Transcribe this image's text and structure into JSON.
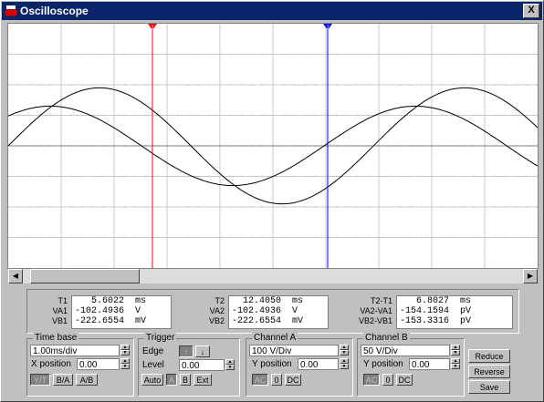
{
  "window": {
    "title": "Oscilloscope",
    "close_label": "X"
  },
  "markers": {
    "t1_label": "1",
    "t2_label": "2",
    "t1_color": "#ff0000",
    "t2_color": "#0000ff"
  },
  "readout": {
    "g1": {
      "labels": [
        "T1",
        "VA1",
        "VB1"
      ],
      "values": [
        "   5.6022  ms",
        "-102.4936  V",
        "-222.6554  mV"
      ]
    },
    "g2": {
      "labels": [
        "T2",
        "VA2",
        "VB2"
      ],
      "values": [
        "  12.4050  ms",
        "-102.4936  V",
        "-222.6554  mV"
      ]
    },
    "g3": {
      "labels": [
        "T2-T1",
        "VA2-VA1",
        "VB2-VB1"
      ],
      "values": [
        "   6.8027  ms",
        "-154.1594  pV",
        "-153.3316  pV"
      ]
    }
  },
  "timebase": {
    "title": "Time base",
    "scale": "1.00ms/div",
    "xpos_label": "X position",
    "xpos": "0.00",
    "buttons": [
      "Y/T",
      "B/A",
      "A/B"
    ]
  },
  "trigger": {
    "title": "Trigger",
    "edge_label": "Edge",
    "edge_rise": "↑",
    "edge_fall": "↓",
    "level_label": "Level",
    "level": "0.00",
    "buttons": [
      "Auto",
      "A",
      "B",
      "Ext"
    ]
  },
  "channel_a": {
    "title": "Channel A",
    "scale": "100 V/Div",
    "ypos_label": "Y position",
    "ypos": "0.00",
    "buttons": [
      "AC",
      "0",
      "DC"
    ]
  },
  "channel_b": {
    "title": "Channel B",
    "scale": "50 V/Div",
    "ypos_label": "Y position",
    "ypos": "0.00",
    "buttons": [
      "AC",
      "0",
      "DC"
    ]
  },
  "side_buttons": [
    "Reduce",
    "Reverse",
    "Save"
  ],
  "waveforms": {
    "channel_a": {
      "period_ms": 6.9,
      "peak_div": 1.9,
      "phase": 0.0
    },
    "channel_b": {
      "period_ms": 6.9,
      "peak_div": 1.3,
      "phase": 0.85
    },
    "color": "#000000",
    "grid_color": "#c8c8c8"
  }
}
